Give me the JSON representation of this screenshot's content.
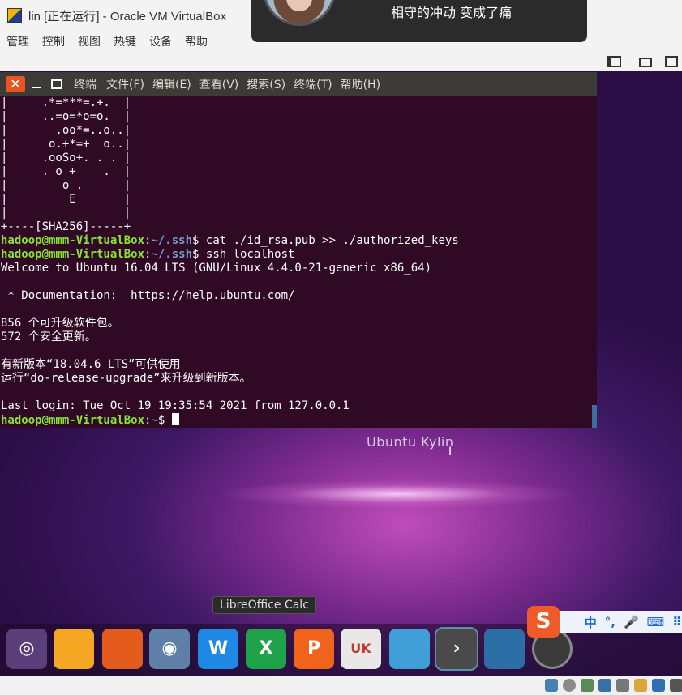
{
  "host": {
    "title": "lin [正在运行] - Oracle VM VirtualBox",
    "menu": [
      "管理",
      "控制",
      "视图",
      "热键",
      "设备",
      "帮助"
    ]
  },
  "music_popup": {
    "song": "相守的冲动 变成了痛"
  },
  "terminal": {
    "window_title": "终端",
    "menu": [
      "文件(F)",
      "编辑(E)",
      "查看(V)",
      "搜索(S)",
      "终端(T)",
      "帮助(H)"
    ],
    "prompt_user": "hadoop@mmm-VirtualBox",
    "art_lines": [
      "|     .*=***=.+.  |",
      "|     ..=o=*o=o.  |",
      "|       .oo*=..o..|",
      "|      o.+*=+  o..|",
      "|     .ooSo+. . . |",
      "|     . o +    .  |",
      "|        o .      |",
      "|         E       |",
      "|                 |",
      "+----[SHA256]-----+"
    ],
    "cmd1_path": "~/.ssh",
    "cmd1": " cat ./id_rsa.pub >> ./authorized_keys",
    "cmd2_path": "~/.ssh",
    "cmd2": " ssh localhost",
    "output": [
      "Welcome to Ubuntu 16.04 LTS (GNU/Linux 4.4.0-21-generic x86_64)",
      "",
      " * Documentation:  https://help.ubuntu.com/",
      "",
      "856 个可升级软件包。",
      "572 个安全更新。",
      "",
      "有新版本“18.04.6 LTS”可供使用",
      "运行“do-release-upgrade”来升级到新版本。",
      "",
      "Last login: Tue Oct 19 19:35:54 2021 from 127.0.0.1"
    ],
    "final_path": "~"
  },
  "desktop": {
    "distro_label": "Ubuntu Kylin",
    "dock_tooltip": "LibreOffice Calc",
    "dock_items": [
      {
        "name": "ubuntu-kylin-menu-icon",
        "glyph": "◎",
        "color": "#5a3f7a"
      },
      {
        "name": "files-folder-icon",
        "glyph": "",
        "color": "#f5a623"
      },
      {
        "name": "firefox-icon",
        "glyph": "",
        "color": "#e35b1d"
      },
      {
        "name": "chromium-icon",
        "glyph": "◉",
        "color": "#5e7fa8"
      },
      {
        "name": "wps-writer-icon",
        "glyph": "W",
        "color": "#1e88e5"
      },
      {
        "name": "wps-spreadsheet-icon",
        "glyph": "X",
        "color": "#1fa34a"
      },
      {
        "name": "wps-presentation-icon",
        "glyph": "P",
        "color": "#f0631b"
      },
      {
        "name": "youker-assistant-icon",
        "glyph": "UK",
        "color": "#e8e8e8"
      },
      {
        "name": "software-center-icon",
        "glyph": "",
        "color": "#3f9fd6"
      },
      {
        "name": "terminal-icon",
        "glyph": "›",
        "color": "#4a4a4a"
      },
      {
        "name": "workspace-switcher-icon",
        "glyph": "",
        "color": "#2c6fa6"
      },
      {
        "name": "dvd-disc-icon",
        "glyph": "",
        "color": "#3a3a3a"
      }
    ]
  },
  "ime": {
    "logo": "S",
    "mode": "中",
    "punct": "°,",
    "voice": "🎤",
    "keyboard": "⌨",
    "grid": "⠿"
  }
}
